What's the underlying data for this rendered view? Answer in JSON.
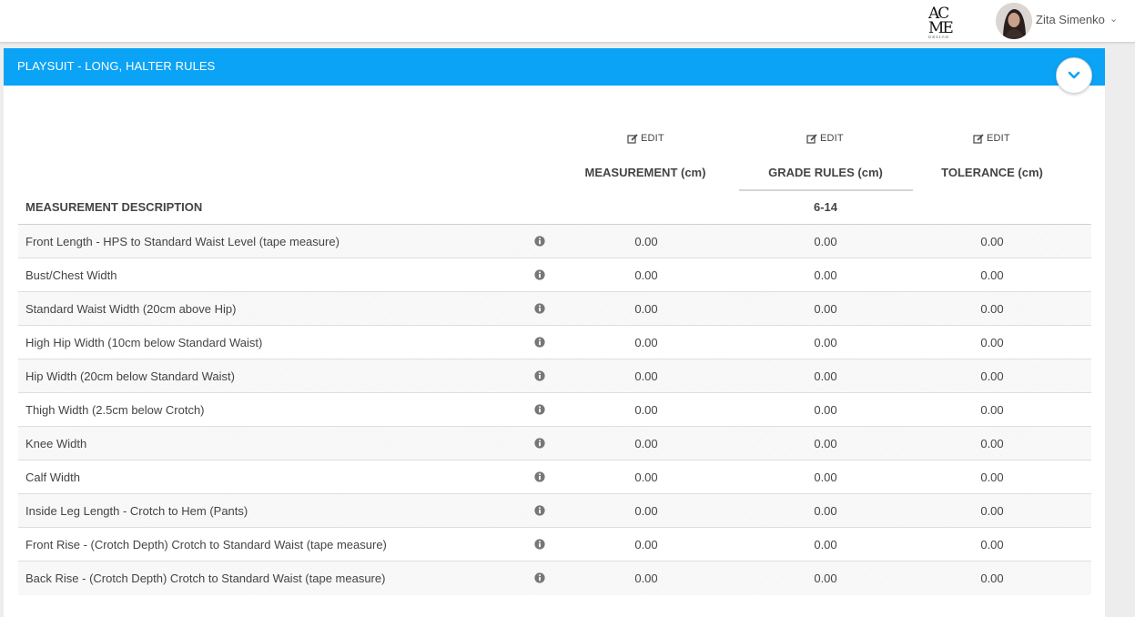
{
  "header": {
    "logo_line1": "AC",
    "logo_line2": "ME",
    "logo_small": "DESIGN",
    "user_name": "Zita Simenko",
    "user_caret": "⌄"
  },
  "panel": {
    "title": "PLAYSUIT - LONG, HALTER RULES",
    "accent_color": "#0aa3f5"
  },
  "columns": {
    "edit_label": "EDIT",
    "measurement": "MEASUREMENT (cm)",
    "grade_rules": "GRADE RULES (cm)",
    "tolerance": "TOLERANCE (cm)",
    "description": "MEASUREMENT DESCRIPTION",
    "size_range": "6-14"
  },
  "rows": [
    {
      "description": "Front Length - HPS to Standard Waist Level (tape measure)",
      "measurement": "0.00",
      "grade": "0.00",
      "tolerance": "0.00"
    },
    {
      "description": "Bust/Chest Width",
      "measurement": "0.00",
      "grade": "0.00",
      "tolerance": "0.00"
    },
    {
      "description": "Standard Waist Width (20cm above Hip)",
      "measurement": "0.00",
      "grade": "0.00",
      "tolerance": "0.00"
    },
    {
      "description": "High Hip Width (10cm below Standard Waist)",
      "measurement": "0.00",
      "grade": "0.00",
      "tolerance": "0.00"
    },
    {
      "description": "Hip Width (20cm below Standard Waist)",
      "measurement": "0.00",
      "grade": "0.00",
      "tolerance": "0.00"
    },
    {
      "description": "Thigh Width (2.5cm below Crotch)",
      "measurement": "0.00",
      "grade": "0.00",
      "tolerance": "0.00"
    },
    {
      "description": "Knee Width",
      "measurement": "0.00",
      "grade": "0.00",
      "tolerance": "0.00"
    },
    {
      "description": "Calf Width",
      "measurement": "0.00",
      "grade": "0.00",
      "tolerance": "0.00"
    },
    {
      "description": "Inside Leg Length - Crotch to Hem (Pants)",
      "measurement": "0.00",
      "grade": "0.00",
      "tolerance": "0.00"
    },
    {
      "description": "Front Rise - (Crotch Depth) Crotch to Standard Waist (tape measure)",
      "measurement": "0.00",
      "grade": "0.00",
      "tolerance": "0.00"
    },
    {
      "description": "Back Rise - (Crotch Depth) Crotch to Standard Waist (tape measure)",
      "measurement": "0.00",
      "grade": "0.00",
      "tolerance": "0.00"
    }
  ]
}
